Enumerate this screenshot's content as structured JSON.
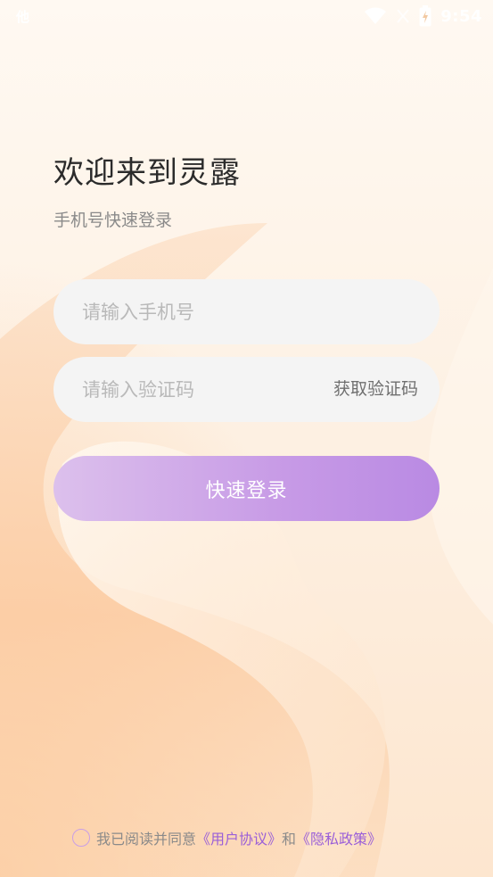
{
  "status_bar": {
    "carrier_badge": "他",
    "time": "9:54",
    "icons": [
      "wifi-icon",
      "no-signal-icon",
      "battery-charging-icon"
    ]
  },
  "welcome": {
    "title": "欢迎来到灵露",
    "subtitle": "手机号快速登录"
  },
  "form": {
    "phone_placeholder": "请输入手机号",
    "phone_value": "",
    "code_placeholder": "请输入验证码",
    "code_value": "",
    "get_code_label": "获取验证码",
    "login_label": "快速登录"
  },
  "agreement": {
    "prefix": "我已阅读并同意",
    "user_agreement": "《用户协议》",
    "joiner": "和",
    "privacy_policy": "《隐私政策》",
    "checked": false
  },
  "colors": {
    "accent": "#b98ae3",
    "link": "#9a5fd8",
    "background_warm": "#fde6cf",
    "input_bg": "#f4f4f4"
  }
}
